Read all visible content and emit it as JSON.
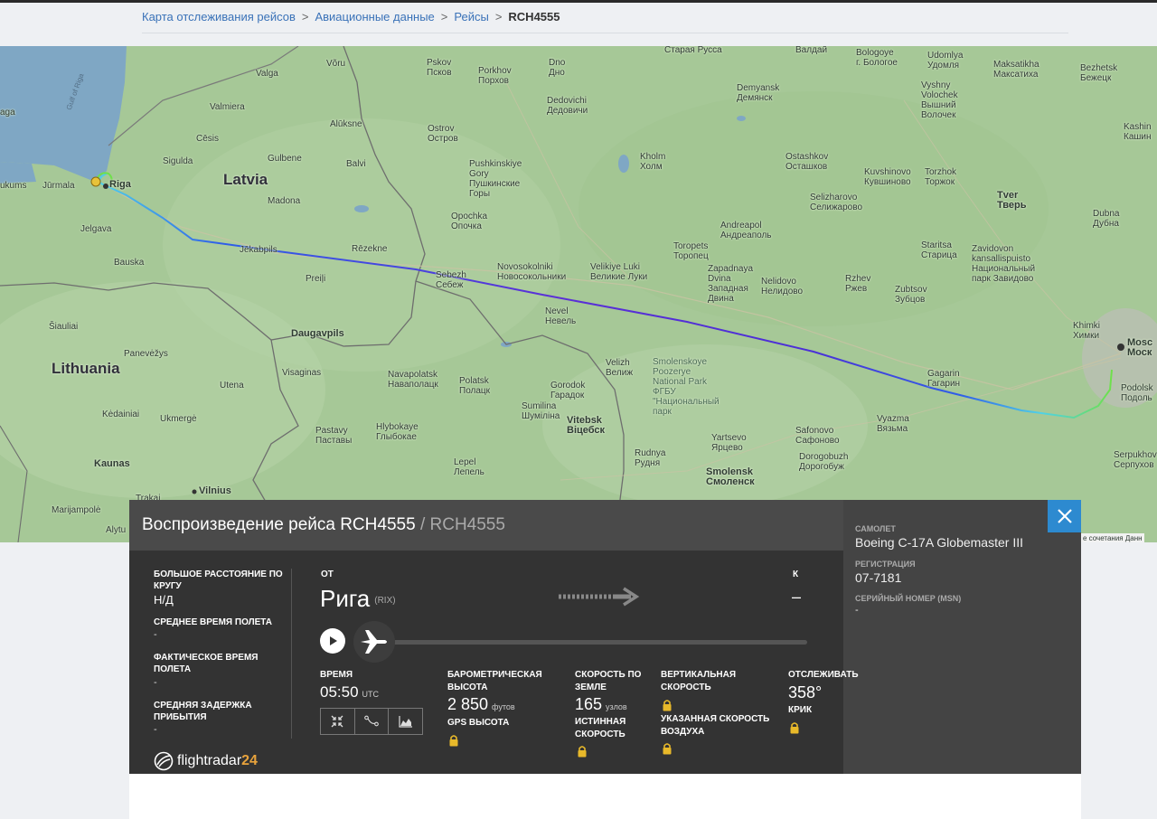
{
  "breadcrumb": {
    "items": [
      "Карта отслеживания рейсов",
      "Авиационные данные",
      "Рейсы"
    ],
    "separator": ">",
    "current": "RCH4555"
  },
  "map": {
    "labels": {
      "latvia": "Latvia",
      "lithuania": "Lithuania",
      "riga": "Riga",
      "jurmala": "Jūrmala",
      "jelgava": "Jelgava",
      "bauska": "Bauska",
      "sigulda": "Sigulda",
      "cesis": "Cēsis",
      "valmiera": "Valmiera",
      "valga": "Valga",
      "voru": "Võru",
      "aluksne": "Alūksne",
      "gulbene": "Gulbene",
      "balvi": "Balvi",
      "madona": "Madona",
      "jekabpils": "Jēkabpils",
      "rezekne": "Rēzekne",
      "preili": "Preiļi",
      "daugavpils": "Daugavpils",
      "visaginas": "Visaginas",
      "utena": "Utena",
      "panevezys": "Panevėžys",
      "siauliai": "Šiauliai",
      "kedainiai": "Kėdainiai",
      "ukmerge": "Ukmergė",
      "kaunas": "Kaunas",
      "vilnius": "Vilnius",
      "marijampole": "Marijampolė",
      "trakai": "Trakai",
      "alytus": "Alytu",
      "tukums": "ukums",
      "aga": "aga",
      "pskov": "Pskov\nПсков",
      "porkhov": "Porkhov\nПорхов",
      "dno": "Dno\nДно",
      "ostrov": "Ostrov\nОстров",
      "dedovichi": "Dedovichi\nДедовичи",
      "pushkinskiye": "Pushkinskiye\nGory\nПушкинские\nГоры",
      "kholm": "Kholm\nХолм",
      "opochka": "Opochka\nОпочка",
      "sebezh": "Sebezh\nСебеж",
      "novosokolniki": "Novosokolniki\nНовосокольники",
      "velikiye_luki": "Velikiye Luki\nВеликие Луки",
      "nevel": "Nevel\nНевель",
      "demyansk": "Demyansk\nДемянск",
      "ostashkov": "Ostashkov\nОсташков",
      "selizharovo": "Selizharovo\nСелижарово",
      "andreapol": "Andreapol\nАндреаполь",
      "toropets": "Toropets\nТоропец",
      "zapadnaya_dvina": "Zapadnaya\nDvina\nЗападная\nДвина",
      "nelidovo": "Nelidovo\nНелидово",
      "rzhev": "Rzhev\nРжев",
      "zubtsov": "Zubtsov\nЗубцов",
      "staritsa": "Staritsa\nСтарица",
      "zavidovo": "Zavidovon\nkansallispuisto\nНациональный\nпарк Завидово",
      "tver": "Tver\nТверь",
      "torzhok": "Torzhok\nТоржок",
      "kuvshinovo": "Kuvshinovo\nКувшиново",
      "vyshny": "Vyshny\nVolochek\nВышний\nВолочек",
      "valdai": "Валдай",
      "bologoye": "Bologoye\nг. Бологое",
      "udomlya": "Udomlya\nУдомля",
      "maksatikha": "Maksatikha\nМаксатиха",
      "bezhetsk": "Bezhetsk\nБежецк",
      "kashin": "Kashin\nКашин",
      "dubna": "Dubna\nДубна",
      "khimki": "Khimki\nХимки",
      "moscow": "Mosc\nМоск",
      "podolsk": "Podolsk\nПодоль",
      "serpukhov": "Serpukhov\nСерпухов",
      "gagarin": "Gagarin\nГагарин",
      "vyazma": "Vyazma\nВязьма",
      "safonovo": "Safonovo\nСафоново",
      "yartsevo": "Yartsevo\nЯрцево",
      "dorogobuzh": "Dorogobuzh\nДорогобуж",
      "smolensk": "Smolensk\nСмоленск",
      "rudnya": "Rudnya\nРудня",
      "smolensk_park": "Smolenskoye\nPoozerye\nNational Park\nФГБУ\n\"Национальный\nпарк",
      "velizh": "Velizh\nВелиж",
      "gorodok": "Gorodok\nГарадок",
      "vitebsk": "Vitebsk\nВіцебск",
      "sumilino": "Sumilina\nШуміліна",
      "polatsk": "Polatsk\nПолацк",
      "navapolatsk": "Navapolatsk\nНаваполацк",
      "hlybokaye": "Hlybokaye\nГлыбокае",
      "pastavy": "Pastavy\nПаставы",
      "lepel": "Lepel\nЛепель",
      "staraya_russa": "Старая Русса",
      "gulf": "Gulf of Riga",
      "attribution": "е сочетания   Данн"
    },
    "route_colors": [
      "#6fe04a",
      "#4fd1e8",
      "#2f5ee8",
      "#5b2fd6"
    ]
  },
  "card": {
    "title_main": "Воспроизведение рейса RCH4555",
    "title_sep": "/",
    "title_alt": "RCH4555",
    "left": {
      "great_circle_label": "БОЛЬШОЕ РАССТОЯНИЕ ПО КРУГУ",
      "great_circle_value": "Н/Д",
      "avg_flight_time_label": "СРЕДНЕЕ ВРЕМЯ ПОЛЕТА",
      "avg_flight_time_value": "-",
      "actual_flight_time_label": "ФАКТИЧЕСКОЕ ВРЕМЯ ПОЛЕТА",
      "actual_flight_time_value": "-",
      "avg_arrival_delay_label": "СРЕДНЯЯ ЗАДЕРЖКА ПРИБЫТИЯ",
      "avg_arrival_delay_value": "-"
    },
    "route": {
      "from_label": "ОТ",
      "from_city": "Рига",
      "from_code": "(RIX)",
      "to_label": "К",
      "to_city": "–"
    },
    "stats": {
      "time_label": "ВРЕМЯ",
      "time_value": "05:50",
      "time_unit": "UTC",
      "baro_alt_label": "БАРОМЕТРИЧЕСКАЯ ВЫСОТА",
      "baro_alt_value": "2 850",
      "baro_alt_unit": "футов",
      "gps_alt_label": "GPS ВЫСОТА",
      "ground_speed_label": "СКОРОСТЬ ПО ЗЕМЛЕ",
      "ground_speed_value": "165",
      "ground_speed_unit": "узлов",
      "true_airspeed_label": "ИСТИННАЯ СКОРОСТЬ",
      "vertical_speed_label": "ВЕРТИКАЛЬНАЯ СКОРОСТЬ",
      "indicated_airspeed_label": "УКАЗАННАЯ СКОРОСТЬ ВОЗДУХА",
      "track_label": "ОТСЛЕЖИВАТЬ",
      "track_value": "358°",
      "squawk_label": "КРИК"
    },
    "aircraft": {
      "aircraft_label": "САМОЛЕТ",
      "aircraft_value": "Boeing C-17A Globemaster III",
      "registration_label": "РЕГИСТРАЦИЯ",
      "registration_value": "07-7181",
      "msn_label": "СЕРИЙНЫЙ НОМЕР (MSN)",
      "msn_value": "-"
    },
    "logo": {
      "text_main": "flightradar",
      "text_num": "24"
    }
  }
}
